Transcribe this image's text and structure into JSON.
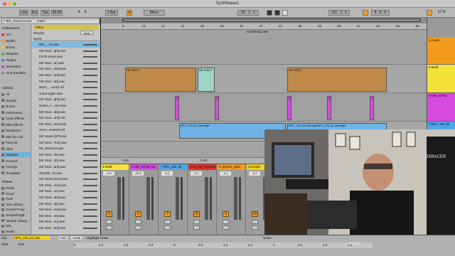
{
  "window": {
    "title": "Synthwave1"
  },
  "transport": {
    "link": "Link",
    "ext": "Ext",
    "tap": "Tap",
    "tempo": "93.00",
    "sig_num": "4",
    "sig_den": "4",
    "quant": "1 Bar",
    "key": "A",
    "scale": "Minor",
    "position": "29 . 1 . 1",
    "loop_start": "121 . 1 . 1",
    "loop_len": "8 . 0 . 0",
    "cpu": "11 %"
  },
  "browser": {
    "breadcrumb": "80s_Snare12.wav",
    "search_value": "snare",
    "filters_label": "Filters",
    "results_label": "Results",
    "clear_label": "Clear",
    "name_header": "Name",
    "collections_label": "Collections",
    "library_label": "Library",
    "places_label": "Places",
    "collections": [
      {
        "label": "UVI",
        "color": "#e0312a"
      },
      {
        "label": "Synths",
        "color": "#f39a1d"
      },
      {
        "label": "Drums",
        "color": "#f3d21d"
      },
      {
        "label": "Samples",
        "color": "#3fb54a"
      },
      {
        "label": "Plugins",
        "color": "#3f86d6"
      },
      {
        "label": "Generative",
        "color": "#9a4fd6"
      },
      {
        "label": "Amp Emulatio",
        "color": "#888888"
      }
    ],
    "library": [
      "All",
      "Sounds",
      "Drums",
      "Instruments",
      "Audio Effects",
      "MIDI Effects",
      "Modulators",
      "Max for Live",
      "Plug-Ins",
      "Clips",
      "Samples",
      "Grooves",
      "Tunings",
      "Templates"
    ],
    "library_selected": "Samples",
    "places": [
      "Packs",
      "Cloud",
      "Push",
      "User Library",
      "Current Proje",
      "SongwritingB",
      "Sample Library",
      "NRL",
      "Studio",
      "Splice"
    ],
    "files": [
      "80s_...12.wav",
      "MZ Snar...ght].wav",
      "CR78 snare.wav",
      "MZ Snar...ar].wav",
      "MZ Snar...ess].wav",
      "MZ Snar...nel].wav",
      "MZ Snar...aft].wav",
      "storm_...um21.aif",
      "snare-again.wav",
      "MZ Snar...ght].wav",
      "Snare_A...e23.wav",
      "MZ Snar...ala].wav",
      "MZ Snar...ant].wav",
      "MZ Snar...ess].wav",
      "storm_snare22.aif",
      "MZ Snare [SP].wav",
      "MZ Snar...Tus].wav",
      "D6_Snare12.wav",
      "MZ Snar...ile].wav",
      "MZ Snar...32].wav",
      "MZ Snar...ant].wav",
      "SNARE_75.wav",
      "MZ Snare [Gro].wav",
      "MZ Snar...ess].wav",
      "MZ Snar...ce].wav",
      "MZ Snar...ain].wav",
      "MZ Snar...ity].wav",
      "MZ Snar...ess].wav",
      "MZ Snar...es].wav",
      "MZ Snar...en].wav",
      "MZ Snar...bel].wav"
    ],
    "selected_file_index": 0
  },
  "arrangement": {
    "locator_label": "something new",
    "ruler": [
      "9",
      "13",
      "17",
      "21",
      "25",
      "29",
      "33",
      "37",
      "41",
      "45",
      "49",
      "53",
      "57",
      "61",
      "65",
      "69"
    ],
    "time_ruler": [
      "0:30",
      "0:45",
      "1:00",
      "1:15"
    ],
    "clip_labels": {
      "drums": "NE SHEO",
      "snare": "Sn",
      "synth": "NP2_100_kit_latenight",
      "synth2": "NP2_100_kit_latenightNP2_100_kit_latenight"
    }
  },
  "tracks": [
    {
      "label": "4 Audio",
      "color": "#f39a1d"
    },
    {
      "label": "5 Mold",
      "color": "#f3e23a"
    },
    {
      "label": "6 NW_NTN2",
      "color": "#d64ae0"
    },
    {
      "label": "7 NP2_100_kit",
      "color": "#4fa6e6"
    }
  ],
  "mixer": {
    "strips": [
      {
        "name": "5 Mold",
        "num": "5",
        "color": "#f3e23a",
        "vol": "-3.5"
      },
      {
        "name": "6 NW_NTN2_90",
        "num": "6",
        "color": "#d64ae0",
        "vol": "-10.5"
      },
      {
        "name": "7 NP2_100_kit",
        "num": "7",
        "color": "#4fa6e6",
        "vol": "-6.0"
      },
      {
        "name": "8 FL_CC_Transmi",
        "num": "8",
        "color": "#e0312a",
        "vol": "-6.4"
      },
      {
        "name": "9 spectre_peru",
        "num": "9",
        "color": "#f39a1d",
        "vol": "-0.1"
      },
      {
        "name": "10 Kalim",
        "num": "10",
        "color": "#f3d21d",
        "vol": "-3.2"
      }
    ]
  },
  "detail": {
    "clip_label": "Clip",
    "start_label": "Start",
    "end_label": "End",
    "fold_label": "Fold",
    "scale_label": "Scale",
    "highlight_label": "Highlight Scale",
    "notes_label": "Notes",
    "clip_name": "NP2_100_kit_late",
    "bars": [
      "2",
      "2.2",
      "2.3",
      "2.4",
      "3",
      "3.2",
      "3.3",
      "3.4",
      "4",
      "4.2",
      "4.3",
      "4.4"
    ]
  },
  "watermark": "udemy"
}
